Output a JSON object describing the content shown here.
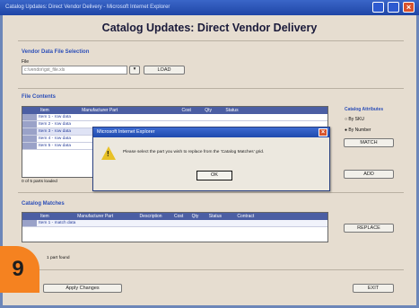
{
  "window": {
    "title": "Catalog Updates: Direct Vendor Delivery - Microsoft Internet Explorer"
  },
  "app": {
    "title": "Catalog Updates: Direct Vendor Delivery"
  },
  "vendor_section": {
    "title": "Vendor Data File Selection",
    "file_label": "File",
    "file_value": "c:\\vendor\\gst_file.xls",
    "browse_icon": "folder-open-icon",
    "load_label": "LOAD"
  },
  "file_contents": {
    "title": "File Contents",
    "columns": [
      "Item",
      "Manufacturer Part",
      "Description",
      "Contract",
      "Cost",
      "Qty",
      "Status"
    ],
    "rows": [
      "Item 1 - row data",
      "Item 2 - row data",
      "Item 3 - row data",
      "Item 4 - row data",
      "Item 5 - row data"
    ],
    "footer": "0 of 5 parts loaded"
  },
  "catalog_side": {
    "title": "Catalog Attributes",
    "option_1": "By SKU",
    "option_2": "By Number",
    "button_1": "MATCH",
    "button_2": "ADD"
  },
  "dialog": {
    "title": "Microsoft Internet Explorer",
    "message": "Please select the part you wish to replace from the 'Catalog Matches' grid.",
    "ok_label": "OK",
    "icon": "warning-icon"
  },
  "catalog_matches": {
    "title": "Catalog Matches",
    "columns": [
      "Item",
      "Manufacturer Part",
      "Description",
      "Cost",
      "Qty",
      "Status",
      "Contract",
      "Date"
    ],
    "rows": [
      "Item 1 - match data"
    ],
    "replace_label": "REPLACE",
    "footer": "1 part found"
  },
  "bottom": {
    "left_button": "Apply Changes",
    "right_button": "EXIT"
  },
  "badge": {
    "number": "9"
  },
  "colors": {
    "accent": "#2d4fb8",
    "badge": "#f58220"
  }
}
